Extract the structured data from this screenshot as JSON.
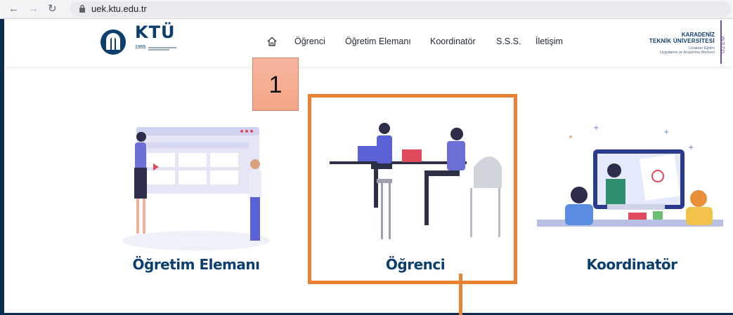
{
  "browser": {
    "url": "uek.ktu.edu.tr"
  },
  "header": {
    "logo_text": "KTÜ",
    "logo_year": "1955",
    "menu": [
      "Öğrenci",
      "Öğretim Elemanı",
      "Koordinatör",
      "S.S.S.",
      "İletişim"
    ],
    "right_logo": {
      "line1": "KARADENİZ",
      "line2": "TEKNİK ÜNİVERSİTESİ",
      "line3": "Uzaktan Eğitim",
      "line4": "Uygulama ve Araştırma Merkezi",
      "side": "UZEM"
    }
  },
  "cards": [
    {
      "label": "Öğretim Elemanı"
    },
    {
      "label": "Öğrenci"
    },
    {
      "label": "Koordinatör"
    }
  ],
  "annotation": {
    "step_number": "1",
    "color": "#e98333"
  }
}
